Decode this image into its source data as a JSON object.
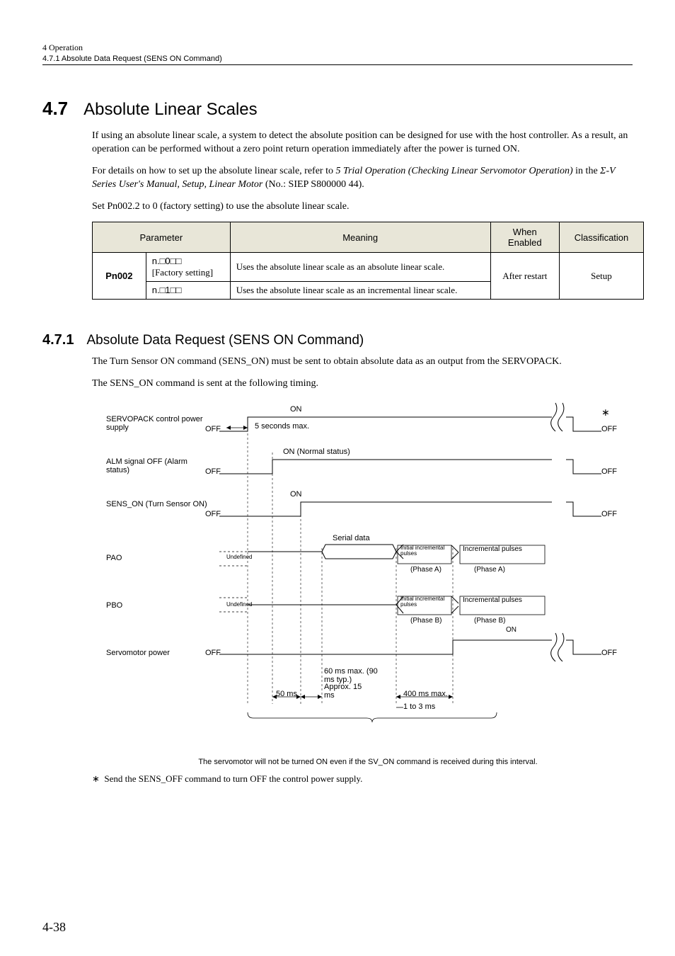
{
  "header": {
    "chapter": "4  Operation",
    "subsection": "4.7.1  Absolute Data Request (SENS ON Command)"
  },
  "section47": {
    "num": "4.7",
    "title": "Absolute Linear Scales",
    "p1": "If using an absolute linear scale, a system to detect the absolute position can be designed for use with the host controller. As a result, an operation can be performed without a zero point return operation immediately after the power is turned ON.",
    "p2a": "For details on how to set up the absolute linear scale, refer to ",
    "p2b": "5 Trial Operation (Checking Linear Servomotor Operation)",
    "p2c": " in the ",
    "p2d": "Σ-V Series User's Manual, Setup, Linear Motor",
    "p2e": " (No.: SIEP S800000 44).",
    "p3": "Set Pn002.2 to 0 (factory setting) to use the absolute linear scale."
  },
  "table": {
    "headers": {
      "param": "Parameter",
      "meaning": "Meaning",
      "when": "When Enabled",
      "class": "Classification"
    },
    "pn": "Pn002",
    "r1val": "n.□0□□",
    "r1fact": "[Factory setting]",
    "r1mean": "Uses the absolute linear scale as an absolute linear scale.",
    "r2val": "n.□1□□",
    "r2mean": "Uses the absolute linear scale as an incremental linear scale.",
    "when": "After restart",
    "class": "Setup"
  },
  "section471": {
    "num": "4.7.1",
    "title": "Absolute Data Request (SENS ON Command)",
    "p1": "The Turn Sensor ON command (SENS_ON) must be sent to obtain absolute data as an output from the SERVOPACK.",
    "p2": "The SENS_ON command is sent at the following timing."
  },
  "diagram": {
    "labels": {
      "servopack": "SERVOPACK control power supply",
      "alm": "ALM signal OFF (Alarm status)",
      "sens": "SENS_ON (Turn Sensor ON)",
      "pao": "PAO",
      "pbo": "PBO",
      "motor": "Servomotor power"
    },
    "states": {
      "on": "ON",
      "off": "OFF",
      "onnormal": "ON (Normal status)",
      "undefined": "Undefined",
      "serial": "Serial data",
      "initpulse": "Initial incremental pulses",
      "incpulse": "Incremental pulses",
      "phaseA": "(Phase A)",
      "phaseB": "(Phase B)"
    },
    "timing": {
      "t5s": "5 seconds max.",
      "t50": "50 ms",
      "t60": "60 ms max. (90 ms typ.)",
      "t15": "Approx. 15 ms",
      "t400": "400 ms max.",
      "t1to3": "1 to 3 ms",
      "star": "∗"
    },
    "caption": "The servomotor will not be turned ON even if the SV_ON command is received during this interval.",
    "footnote": "Send the SENS_OFF command to turn OFF the control power supply."
  },
  "pagenum": "4-38",
  "chart_data": {
    "type": "table",
    "description": "Timing chart for SENS_ON command sequence",
    "signals": [
      {
        "name": "SERVOPACK control power supply",
        "sequence": [
          "OFF",
          "ON (rises)",
          "OFF (at end, after SENS_OFF *)"
        ]
      },
      {
        "name": "ALM signal OFF (Alarm status)",
        "sequence": [
          "OFF",
          "ON (Normal status) after ≤5 s",
          "OFF (at end)"
        ]
      },
      {
        "name": "SENS_ON (Turn Sensor ON)",
        "sequence": [
          "OFF",
          "ON (50 ms after ALM ON)",
          "OFF (at end)"
        ]
      },
      {
        "name": "PAO",
        "sequence": [
          "Undefined",
          "Serial data (after 60 ms max / 90 ms typ from SENS_ON)",
          "Initial incremental pulses (Phase A, after ~15 ms)",
          "Incremental pulses (Phase A, after 1–3 ms)"
        ]
      },
      {
        "name": "PBO",
        "sequence": [
          "Undefined",
          "(idle during serial data)",
          "Initial incremental pulses (Phase B)",
          "Incremental pulses (Phase B)"
        ]
      },
      {
        "name": "Servomotor power",
        "sequence": [
          "OFF",
          "ON (≤400 ms after initial pulses start)",
          "OFF (at end)"
        ]
      }
    ],
    "intervals": [
      {
        "from": "Control power ON",
        "to": "ALM ON",
        "value": "5 seconds max."
      },
      {
        "from": "ALM ON",
        "to": "SENS_ON rising",
        "value": "50 ms"
      },
      {
        "from": "SENS_ON rising",
        "to": "PAO serial data start",
        "value": "60 ms max. (90 ms typ.)"
      },
      {
        "from": "Serial data end",
        "to": "Initial incremental pulses start",
        "value": "Approx. 15 ms"
      },
      {
        "from": "Initial incremental pulses start",
        "to": "Servomotor power ON",
        "value": "400 ms max."
      },
      {
        "from": "Initial incremental pulses end",
        "to": "Incremental pulses start",
        "value": "1 to 3 ms"
      },
      {
        "note": "Servomotor will not be turned ON even if SV_ON is received during the brace interval (SENS_ON to incremental pulses)"
      }
    ]
  }
}
